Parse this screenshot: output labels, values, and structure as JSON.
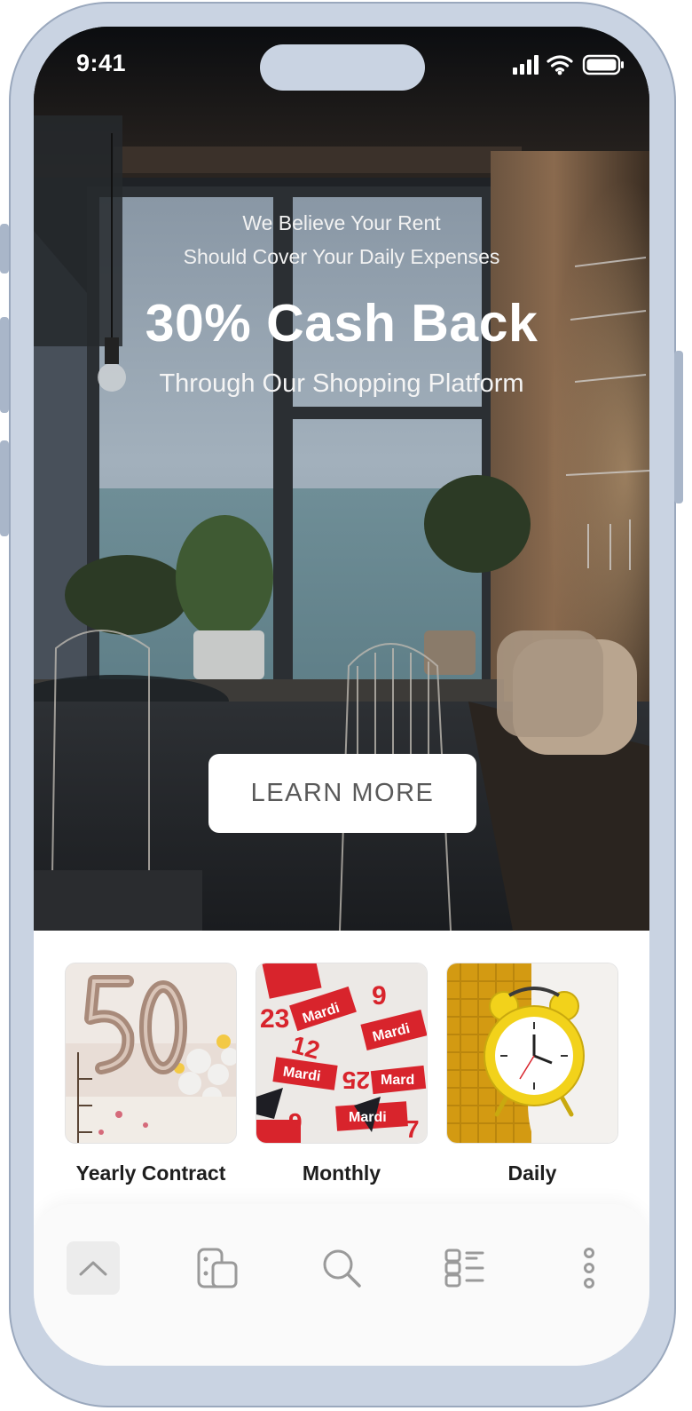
{
  "status_bar": {
    "time": "9:41"
  },
  "hero": {
    "tagline_line1": "We Believe Your Rent",
    "tagline_line2": "Should Cover Your Daily Expenses",
    "headline": "30% Cash Back",
    "subheadline": "Through Our Shopping Platform",
    "cta_label": "LEARN MORE"
  },
  "categories": [
    {
      "label": "Yearly Contract",
      "image": "balloon-50-photo"
    },
    {
      "label": "Monthly",
      "image": "calendar-pages-photo"
    },
    {
      "label": "Daily",
      "image": "alarm-clock-photo"
    }
  ],
  "bottom_nav": [
    {
      "name": "up",
      "icon": "chevron-up-icon",
      "active": true
    },
    {
      "name": "cards",
      "icon": "cards-icon",
      "active": false
    },
    {
      "name": "search",
      "icon": "search-icon",
      "active": false
    },
    {
      "name": "list",
      "icon": "list-icon",
      "active": false
    },
    {
      "name": "more",
      "icon": "more-vertical-icon",
      "active": false
    }
  ],
  "colors": {
    "frame": "#c9d3e2",
    "button_text": "#5a5a5a",
    "nav_icon": "#9a9a9a",
    "accent_yellow": "#f2d21b",
    "calendar_red": "#d8242c"
  }
}
